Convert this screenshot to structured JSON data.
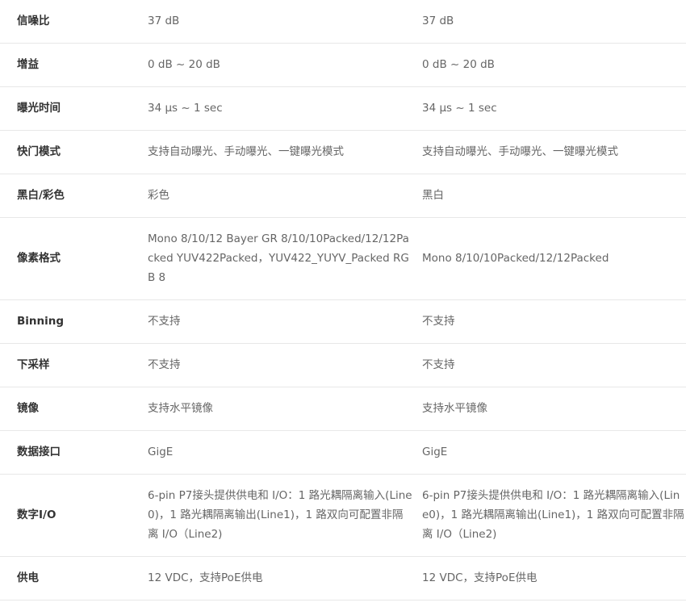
{
  "rows": [
    {
      "label": "信噪比",
      "col1": "37 dB",
      "col2": "37 dB"
    },
    {
      "label": "增益",
      "col1": "0 dB ~ 20 dB",
      "col2": "0 dB ~ 20 dB"
    },
    {
      "label": "曝光时间",
      "col1": "34 μs ~ 1 sec",
      "col2": "34 μs ~ 1 sec"
    },
    {
      "label": "快门模式",
      "col1": "支持自动曝光、手动曝光、一键曝光模式",
      "col2": "支持自动曝光、手动曝光、一键曝光模式"
    },
    {
      "label": "黑白/彩色",
      "col1": "彩色",
      "col2": "黑白"
    },
    {
      "label": "像素格式",
      "col1": "Mono 8/10/12 Bayer GR 8/10/10Packed/12/12Packed YUV422Packed，YUV422_YUYV_Packed RGB 8",
      "col2": "Mono 8/10/10Packed/12/12Packed"
    },
    {
      "label": "Binning",
      "col1": "不支持",
      "col2": "不支持"
    },
    {
      "label": "下采样",
      "col1": "不支持",
      "col2": "不支持"
    },
    {
      "label": "镜像",
      "col1": "支持水平镜像",
      "col2": "支持水平镜像"
    },
    {
      "label": "数据接口",
      "col1": "GigE",
      "col2": "GigE"
    },
    {
      "label": "数字I/O",
      "col1": "6-pin P7接头提供供电和 I/O：1 路光耦隔离输入(Line0)，1 路光耦隔离输出(Line1)，1 路双向可配置非隔离 I/O（Line2)",
      "col2": "6-pin P7接头提供供电和 I/O：1 路光耦隔离输入(Line0)，1 路光耦隔离输出(Line1)，1 路双向可配置非隔离 I/O（Line2)"
    },
    {
      "label": "供电",
      "col1": "12 VDC，支持PoE供电",
      "col2": "12 VDC，支持PoE供电"
    }
  ]
}
